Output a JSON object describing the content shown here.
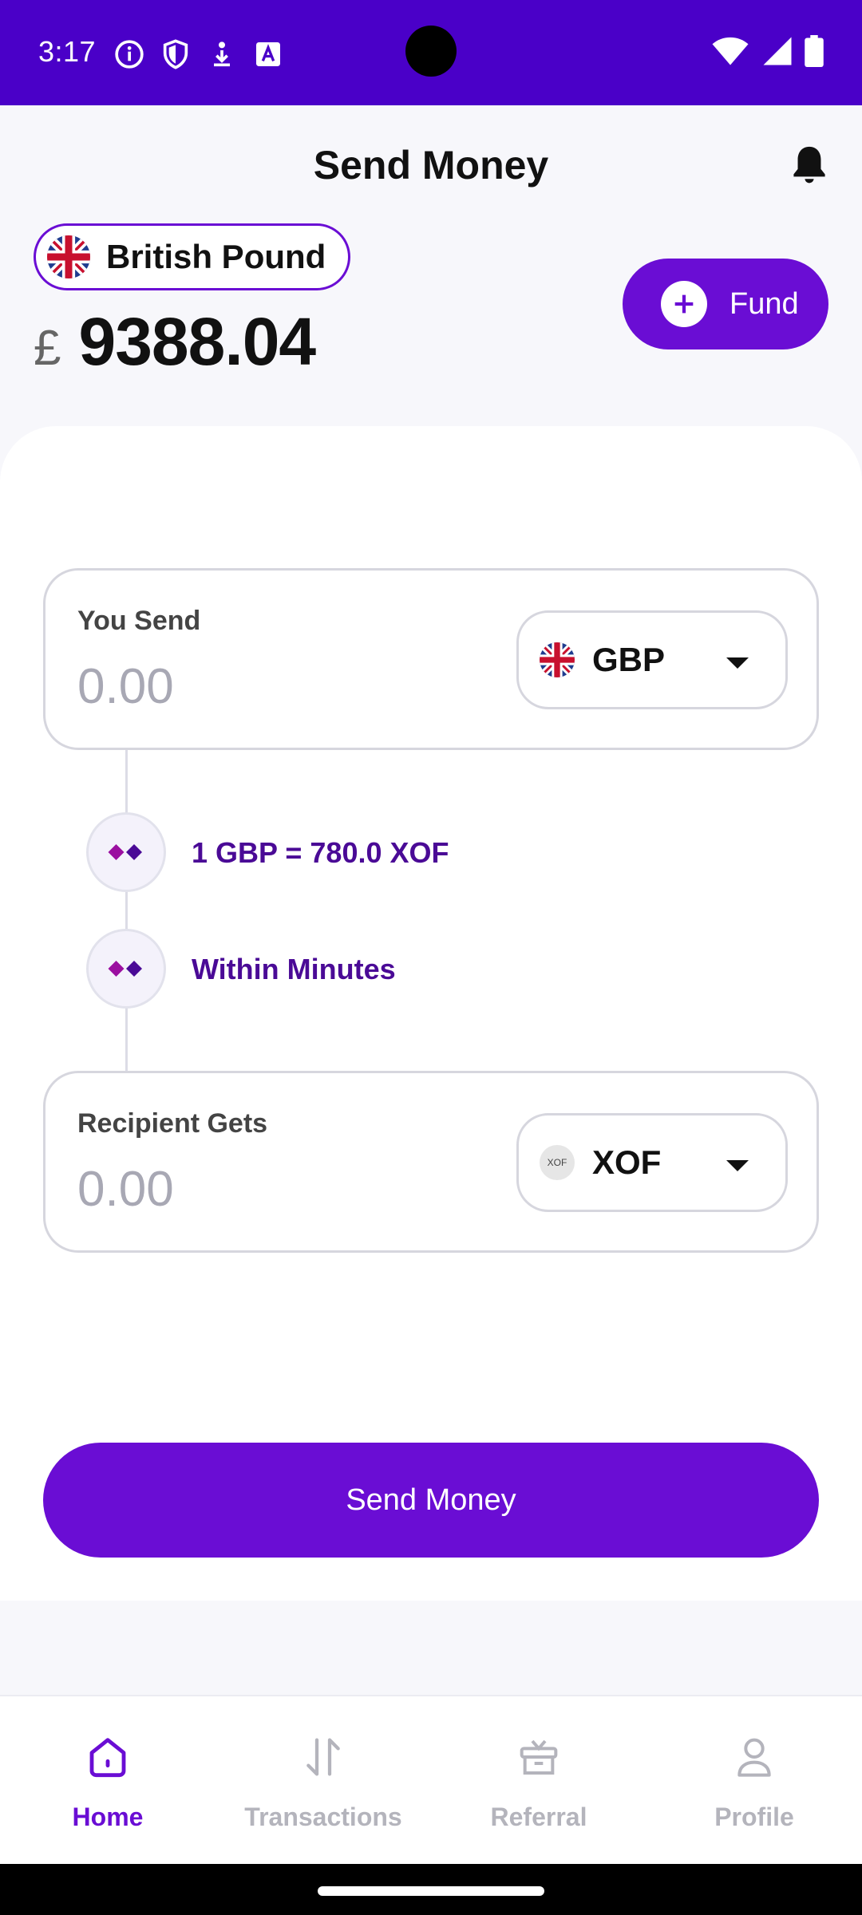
{
  "status_bar": {
    "time": "3:17",
    "left_icons": [
      "info-icon",
      "shield-icon",
      "download-icon",
      "a-icon"
    ],
    "right_icons": [
      "wifi-icon",
      "signal-icon",
      "battery-icon"
    ]
  },
  "header": {
    "title": "Send Money",
    "bell_icon": "bell-icon"
  },
  "wallet": {
    "currency_name": "British Pound",
    "currency_symbol": "£",
    "balance": "9388.04",
    "fund_label": "Fund"
  },
  "send_box": {
    "label": "You Send",
    "value": "0.00",
    "currency_code": "GBP"
  },
  "info": {
    "rate": "1 GBP = 780.0 XOF",
    "speed": "Within Minutes"
  },
  "receive_box": {
    "label": "Recipient Gets",
    "value": "0.00",
    "currency_code": "XOF",
    "badge": "XOF"
  },
  "send_button_label": "Send Money",
  "nav": {
    "items": [
      {
        "label": "Home",
        "icon": "home-icon",
        "active": true
      },
      {
        "label": "Transactions",
        "icon": "transactions-icon",
        "active": false
      },
      {
        "label": "Referral",
        "icon": "gift-icon",
        "active": false
      },
      {
        "label": "Profile",
        "icon": "profile-icon",
        "active": false
      }
    ]
  },
  "colors": {
    "primary": "#6a0dd4",
    "status_bar": "#4a00c8",
    "accent_text": "#4a0a96"
  }
}
